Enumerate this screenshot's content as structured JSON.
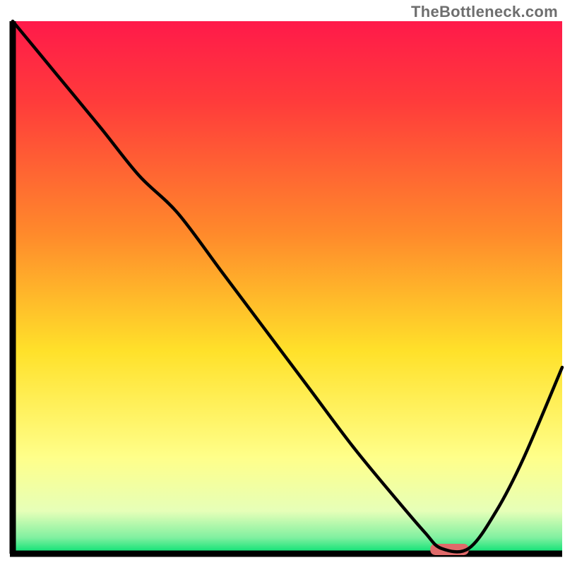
{
  "attribution": "TheBottleneck.com",
  "colors": {
    "gradient_top": "#ff1a4a",
    "gradient_red": "#ff3b3b",
    "gradient_orange": "#ff8a2b",
    "gradient_yellow": "#ffe12a",
    "gradient_paleyellow": "#ffff8a",
    "gradient_palegreen": "#d6ffb0",
    "gradient_green": "#00e070",
    "axis": "#000000",
    "curve": "#000000",
    "marker": "#e06a6a"
  },
  "chart_data": {
    "type": "line",
    "title": "",
    "xlabel": "",
    "ylabel": "",
    "xlim": [
      0,
      100
    ],
    "ylim": [
      0,
      100
    ],
    "curve": {
      "name": "bottleneck-curve",
      "x": [
        0,
        8,
        16,
        23,
        30,
        38,
        46,
        54,
        62,
        70,
        75,
        78,
        83,
        88,
        93,
        100
      ],
      "y": [
        100,
        90,
        80,
        71,
        64,
        53,
        42,
        31,
        20,
        10,
        4,
        1,
        1,
        8,
        18,
        35
      ]
    },
    "optimal_marker": {
      "x_start": 76,
      "x_end": 83,
      "y": 0.8
    },
    "background_gradient_stops": [
      {
        "offset": 0,
        "color": "#ff1a4a"
      },
      {
        "offset": 15,
        "color": "#ff3b3b"
      },
      {
        "offset": 40,
        "color": "#ff8a2b"
      },
      {
        "offset": 62,
        "color": "#ffe12a"
      },
      {
        "offset": 82,
        "color": "#ffff8a"
      },
      {
        "offset": 92,
        "color": "#e6ffb8"
      },
      {
        "offset": 97,
        "color": "#80f0a0"
      },
      {
        "offset": 100,
        "color": "#00e070"
      }
    ]
  }
}
